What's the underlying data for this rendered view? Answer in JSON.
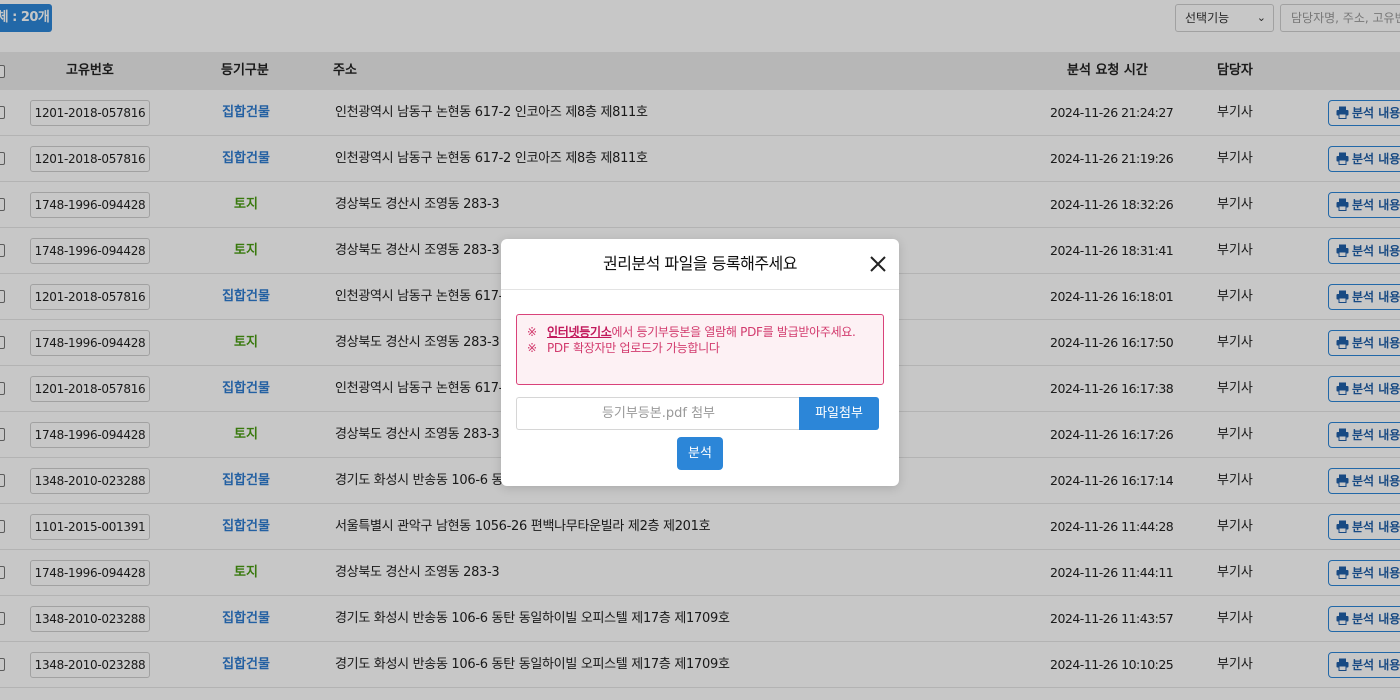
{
  "toolbar": {
    "count_label": "체 : 20개",
    "feature_select": "선택기능",
    "search_placeholder": "담당자명, 주소, 고유번호"
  },
  "table": {
    "headers": {
      "unique_no": "고유번호",
      "reg_type": "등기구분",
      "address": "주소",
      "request_time": "분석 요청 시간",
      "manager": "담당자"
    },
    "view_label": "분석 내용",
    "rows": [
      {
        "id": "1201-2018-057816",
        "type": "집합건물",
        "address": "인천광역시 남동구 논현동 617-2 인코아즈 제8층 제811호",
        "time": "2024-11-26 21:24:27",
        "manager": "부기사"
      },
      {
        "id": "1201-2018-057816",
        "type": "집합건물",
        "address": "인천광역시 남동구 논현동 617-2 인코아즈 제8층 제811호",
        "time": "2024-11-26 21:19:26",
        "manager": "부기사"
      },
      {
        "id": "1748-1996-094428",
        "type": "토지",
        "address": "경상북도 경산시 조영동 283-3",
        "time": "2024-11-26 18:32:26",
        "manager": "부기사"
      },
      {
        "id": "1748-1996-094428",
        "type": "토지",
        "address": "경상북도 경산시 조영동 283-3",
        "time": "2024-11-26 18:31:41",
        "manager": "부기사"
      },
      {
        "id": "1201-2018-057816",
        "type": "집합건물",
        "address": "인천광역시 남동구 논현동 617-2",
        "time": "2024-11-26 16:18:01",
        "manager": "부기사"
      },
      {
        "id": "1748-1996-094428",
        "type": "토지",
        "address": "경상북도 경산시 조영동 283-3",
        "time": "2024-11-26 16:17:50",
        "manager": "부기사"
      },
      {
        "id": "1201-2018-057816",
        "type": "집합건물",
        "address": "인천광역시 남동구 논현동 617-2",
        "time": "2024-11-26 16:17:38",
        "manager": "부기사"
      },
      {
        "id": "1748-1996-094428",
        "type": "토지",
        "address": "경상북도 경산시 조영동 283-3",
        "time": "2024-11-26 16:17:26",
        "manager": "부기사"
      },
      {
        "id": "1348-2010-023288",
        "type": "집합건물",
        "address": "경기도 화성시 반송동 106-6 동탄",
        "time": "2024-11-26 16:17:14",
        "manager": "부기사"
      },
      {
        "id": "1101-2015-001391",
        "type": "집합건물",
        "address": "서울특별시 관악구 남현동 1056-26 편백나무타운빌라 제2층 제201호",
        "time": "2024-11-26 11:44:28",
        "manager": "부기사"
      },
      {
        "id": "1748-1996-094428",
        "type": "토지",
        "address": "경상북도 경산시 조영동 283-3",
        "time": "2024-11-26 11:44:11",
        "manager": "부기사"
      },
      {
        "id": "1348-2010-023288",
        "type": "집합건물",
        "address": "경기도 화성시 반송동 106-6 동탄 동일하이빌 오피스텔 제17층 제1709호",
        "time": "2024-11-26 11:43:57",
        "manager": "부기사"
      },
      {
        "id": "1348-2010-023288",
        "type": "집합건물",
        "address": "경기도 화성시 반송동 106-6 동탄 동일하이빌 오피스텔 제17층 제1709호",
        "time": "2024-11-26 10:10:25",
        "manager": "부기사"
      }
    ]
  },
  "modal": {
    "title": "권리분석 파일을 등록해주세요",
    "notice_mark": "※",
    "notice_link": "인터넷등기소",
    "notice_line1_rest": "에서 등기부등본을 열람해 PDF를 발급받아주세요.",
    "notice_line2": "PDF 확장자만 업로드가 가능합니다",
    "file_placeholder": "등기부등본.pdf 첨부",
    "attach_button": "파일첨부",
    "analyze_button": "분석"
  },
  "colors": {
    "accent": "#2c86d8",
    "type_building": "#2e7bd0",
    "type_land": "#4a9c12",
    "notice": "#d23a6d"
  }
}
